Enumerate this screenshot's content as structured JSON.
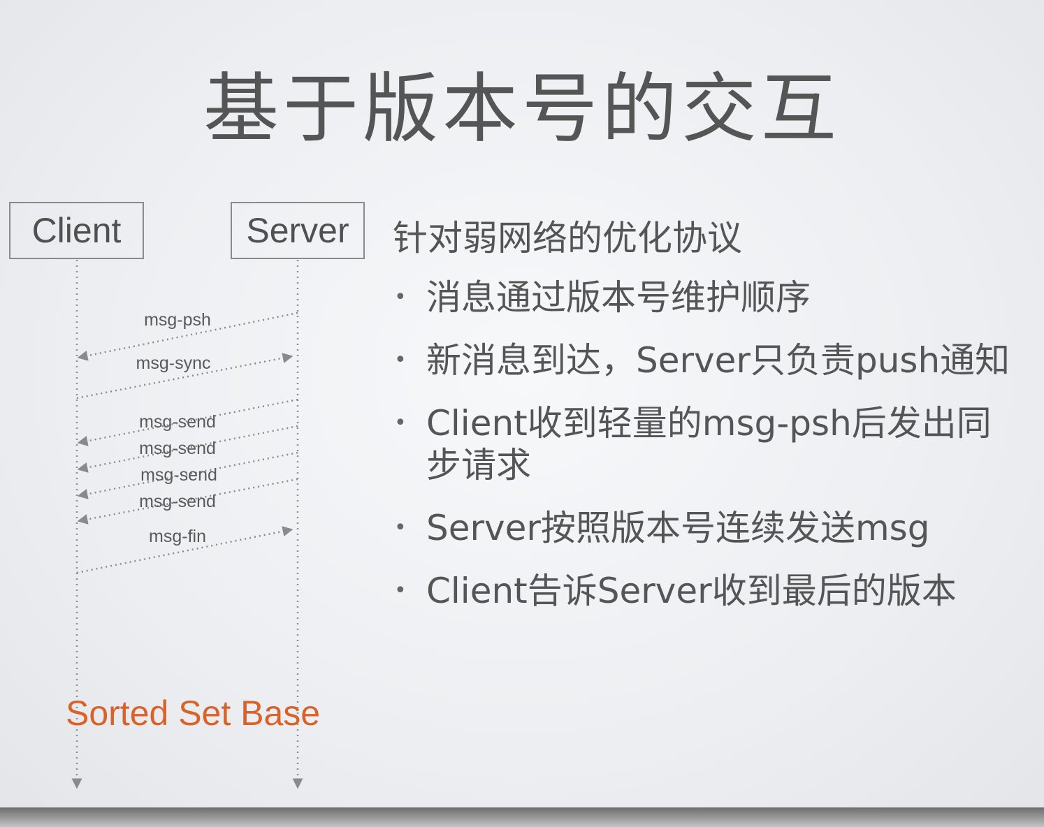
{
  "slide": {
    "title": "基于版本号的交互"
  },
  "diagram": {
    "client_label": "Client",
    "server_label": "Server",
    "messages": [
      {
        "label": "msg-psh",
        "direction": "server-to-client"
      },
      {
        "label": "msg-sync",
        "direction": "client-to-server"
      },
      {
        "label": "msg-send",
        "direction": "server-to-client"
      },
      {
        "label": "msg-send",
        "direction": "server-to-client"
      },
      {
        "label": "msg-send",
        "direction": "server-to-client"
      },
      {
        "label": "msg-send",
        "direction": "server-to-client"
      },
      {
        "label": "msg-fin",
        "direction": "client-to-server"
      }
    ],
    "footer_label": "Sorted Set Base",
    "footer_color": "#d9622b"
  },
  "content": {
    "heading": "针对弱网络的优化协议",
    "bullets": [
      "消息通过版本号维护顺序",
      "新消息到达，Server只负责push通知",
      "Client收到轻量的msg-psh后发出同步请求",
      "Server按照版本号连续发送msg",
      "Client告诉Server收到最后的版本"
    ]
  }
}
